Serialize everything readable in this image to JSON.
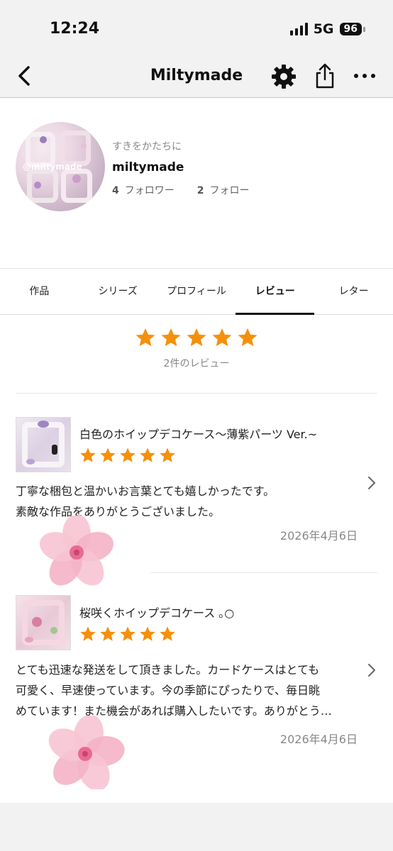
{
  "status_bar": {
    "time": "12:24",
    "network": "5G",
    "battery": "96"
  },
  "nav": {
    "title": "Miltymade"
  },
  "profile": {
    "avatar_text": "@miltymade",
    "tagline": "すきをかたちに",
    "name": "miltymade",
    "followers_count": "4",
    "followers_label": "フォロワー",
    "following_count": "2",
    "following_label": "フォロー"
  },
  "tabs": [
    {
      "label": "作品",
      "active": false
    },
    {
      "label": "シリーズ",
      "active": false
    },
    {
      "label": "プロフィール",
      "active": false
    },
    {
      "label": "レビュー",
      "active": true
    },
    {
      "label": "レター",
      "active": false
    }
  ],
  "summary": {
    "rating": 5,
    "count_text": "2件のレビュー"
  },
  "reviews": [
    {
      "title": "白色のホイップデコケース～薄紫パーツ Ver.~",
      "rating": 5,
      "body_line1": "丁寧な梱包と温かいお言葉とても嬉しかったです。",
      "body_line2": "素敵な作品をありがとうございました。",
      "date": "2026年4月6日"
    },
    {
      "title": "桜咲くホイップデコケース ｡○",
      "rating": 5,
      "body_line1": "とても迅速な発送をして頂きました。カードケースはとても",
      "body_line2": "可愛く、早速使っています。今の季節にぴったりで、毎日眺",
      "body_line3": "めています！また機会があれば購入したいです。ありがとう…",
      "date": "2026年4月6日"
    }
  ],
  "colors": {
    "star": "#f5900c",
    "blossom": "#f2a3bd"
  }
}
